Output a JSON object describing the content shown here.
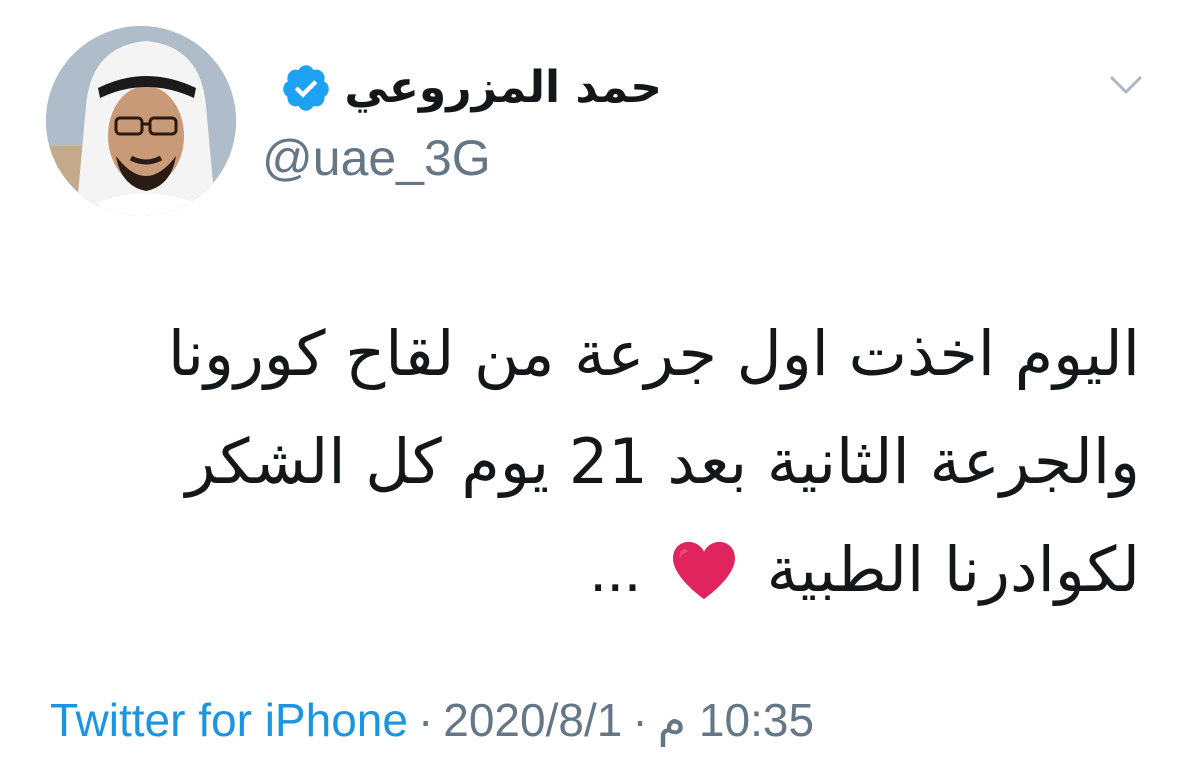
{
  "user": {
    "display_name": "حمد المزروعي",
    "handle": "@uae_3G",
    "verified": true,
    "avatar_icon": "profile-photo"
  },
  "tweet": {
    "lines": [
      "اليوم اخذت اول جرعة من لقاح كورونا",
      "والجرعة الثانية بعد 21 يوم كل الشكر",
      "لكوادرنا الطبية"
    ],
    "trailing_emoji": "red-heart-icon",
    "ellipsis": "..."
  },
  "meta": {
    "source": "Twitter for iPhone",
    "separator": "·",
    "date": "2020/8/1",
    "time": "10:35 م"
  },
  "colors": {
    "accent": "#1b95e0",
    "text": "#14171a",
    "muted": "#657786",
    "verified": "#1da1f2",
    "heart": "#e0245e"
  }
}
